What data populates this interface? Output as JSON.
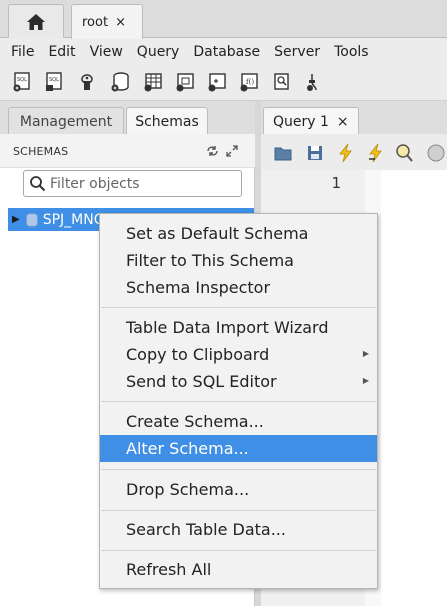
{
  "tabs": {
    "home_icon": "home-icon",
    "connection_tab": "root",
    "close": "×"
  },
  "menu": [
    "File",
    "Edit",
    "View",
    "Query",
    "Database",
    "Server",
    "Tools"
  ],
  "left_panel": {
    "tabs": [
      "Management",
      "Schemas"
    ],
    "header": "SCHEMAS",
    "filter_placeholder": "Filter objects",
    "schema_name": "SPJ_MNG"
  },
  "query_tab": {
    "label": "Query 1",
    "close": "×"
  },
  "editor": {
    "line_number": "1"
  },
  "context_menu": {
    "items": [
      "Set as Default Schema",
      "Filter to This Schema",
      "Schema Inspector",
      "Table Data Import Wizard",
      "Copy to Clipboard",
      "Send to SQL Editor",
      "Create Schema...",
      "Alter Schema...",
      "Drop Schema...",
      "Search Table Data...",
      "Refresh All"
    ],
    "highlighted": "Alter Schema..."
  },
  "colors": {
    "selection": "#3f8fe6",
    "lightning": "#f2c21b"
  }
}
